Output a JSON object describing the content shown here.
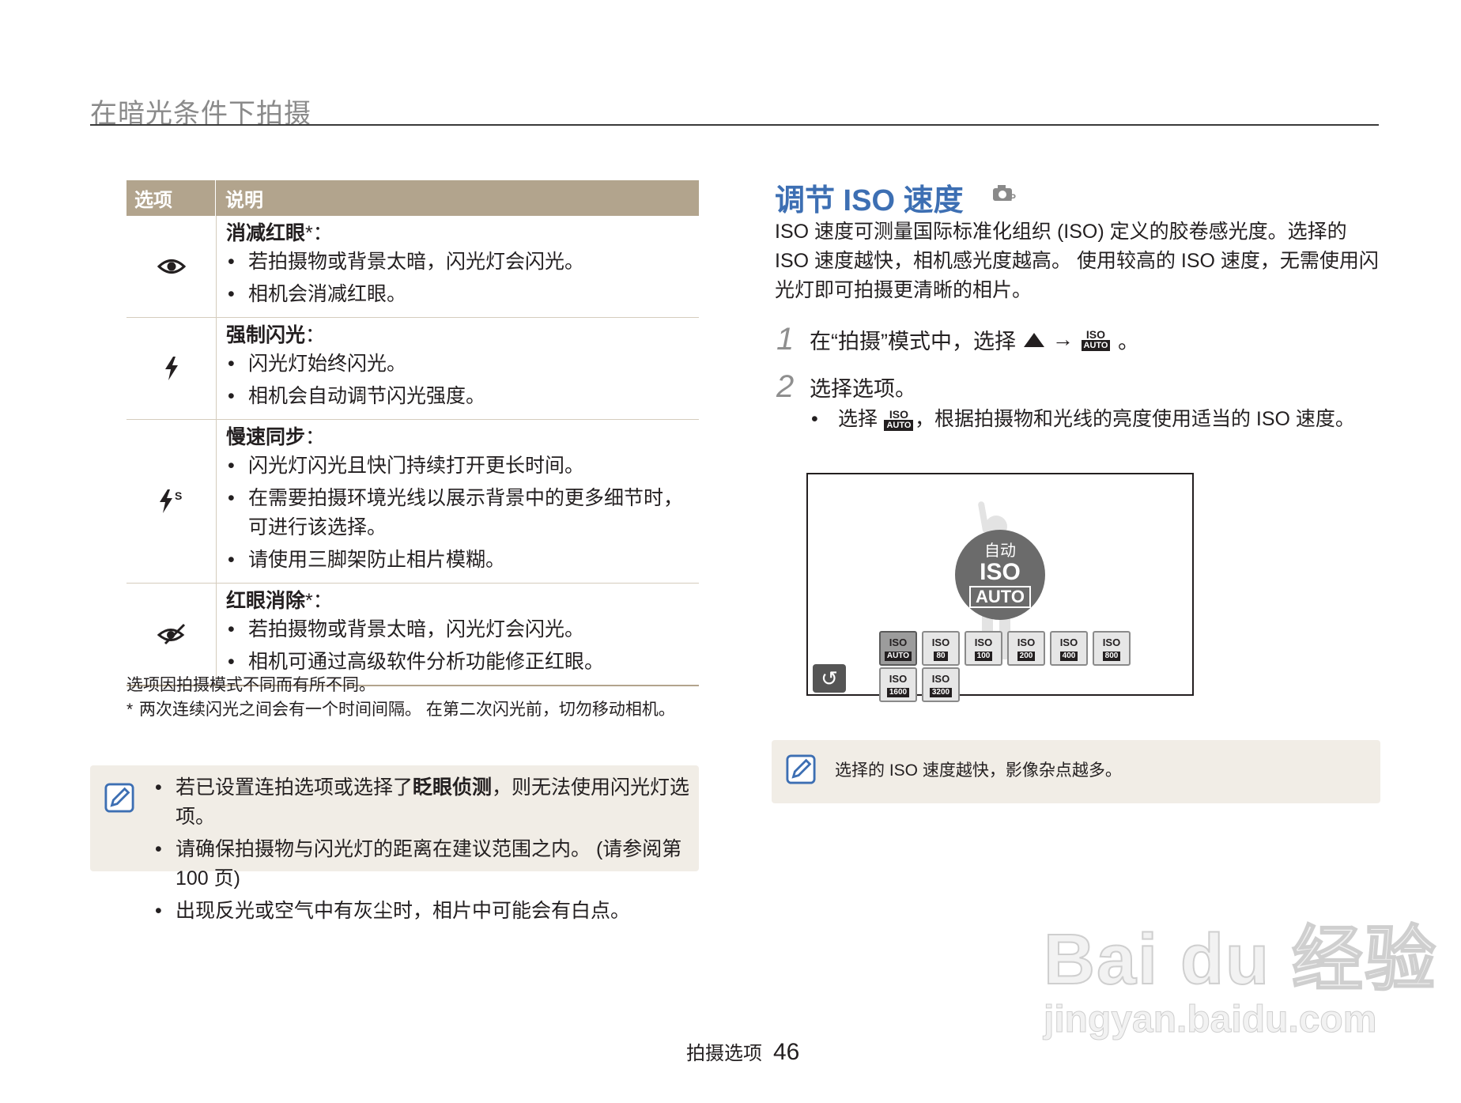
{
  "header": {
    "section_title": "在暗光条件下拍摄"
  },
  "table": {
    "col_option": "选项",
    "col_desc": "说明",
    "rows": [
      {
        "icon": "red-eye-icon",
        "title": "消减红眼",
        "star": "*：",
        "bullets": [
          "若拍摄物或背景太暗，闪光灯会闪光。",
          "相机会消减红眼。"
        ]
      },
      {
        "icon": "fill-in-flash-icon",
        "title": "强制闪光",
        "star": "：",
        "bullets": [
          "闪光灯始终闪光。",
          "相机会自动调节闪光强度。"
        ]
      },
      {
        "icon": "slow-sync-icon",
        "title": "慢速同步",
        "star": "：",
        "bullets": [
          "闪光灯闪光且快门持续打开更长时间。",
          "在需要拍摄环境光线以展示背景中的更多细节时，可进行该选择。",
          "请使用三脚架防止相片模糊。"
        ]
      },
      {
        "icon": "red-eye-fix-icon",
        "title": "红眼消除",
        "star": "*：",
        "bullets": [
          "若拍摄物或背景太暗，闪光灯会闪光。",
          "相机可通过高级软件分析功能修正红眼。"
        ]
      }
    ]
  },
  "footnotes": {
    "line1": "选项因拍摄模式不同而有所不同。",
    "mark": "*",
    "line2": "两次连续闪光之间会有一个时间间隔。 在第二次闪光前，切勿移动相机。"
  },
  "note_left": {
    "items": [
      {
        "pre": "若已设置连拍选项或选择了",
        "bold": "眨眼侦测",
        "post": "，则无法使用闪光灯选项。"
      },
      {
        "pre": "请确保拍摄物与闪光灯的距离在建议范围之内。 (请参阅第 100 页)",
        "bold": "",
        "post": ""
      },
      {
        "pre": "出现反光或空气中有灰尘时，相片中可能会有白点。",
        "bold": "",
        "post": ""
      }
    ]
  },
  "iso_section": {
    "title": "调节 ISO 速度",
    "mode_icon": "program-camera-icon",
    "intro": "ISO 速度可测量国际标准化组织 (ISO) 定义的胶卷感光度。选择的 ISO 速度越快，相机感光度越高。 使用较高的 ISO 速度，无需使用闪光灯即可拍摄更清晰的相片。",
    "step1": {
      "num": "1",
      "text": "在“拍摄”模式中，选择",
      "arrow": "→",
      "end": "。"
    },
    "step2": {
      "num": "2",
      "text": "选择选项。",
      "bullet_pre": "选择",
      "bullet_post": "，根据拍摄物和光线的亮度使用适当的 ISO 速度。"
    },
    "iso_badge": {
      "top": "ISO",
      "bottom": "AUTO"
    }
  },
  "screen": {
    "auto_label": "自动",
    "big_iso": "ISO",
    "big_auto": "AUTO",
    "buttons": [
      {
        "top": "ISO",
        "bottom": "AUTO",
        "selected": true
      },
      {
        "top": "ISO",
        "bottom": "80"
      },
      {
        "top": "ISO",
        "bottom": "100"
      },
      {
        "top": "ISO",
        "bottom": "200"
      },
      {
        "top": "ISO",
        "bottom": "400"
      },
      {
        "top": "ISO",
        "bottom": "800"
      },
      {
        "top": "ISO",
        "bottom": "1600"
      },
      {
        "top": "ISO",
        "bottom": "3200"
      }
    ],
    "back_symbol": "↺"
  },
  "note_right": {
    "text": "选择的 ISO 速度越快，影像杂点越多。"
  },
  "footer": {
    "label": "拍摄选项",
    "page": "46"
  },
  "watermark": {
    "logo": "Bai du 经验",
    "url": "jingyan.baidu.com"
  },
  "colors": {
    "accent_blue": "#3d6fb3",
    "table_header": "#b2a48d",
    "note_bg": "#f1ede6"
  }
}
